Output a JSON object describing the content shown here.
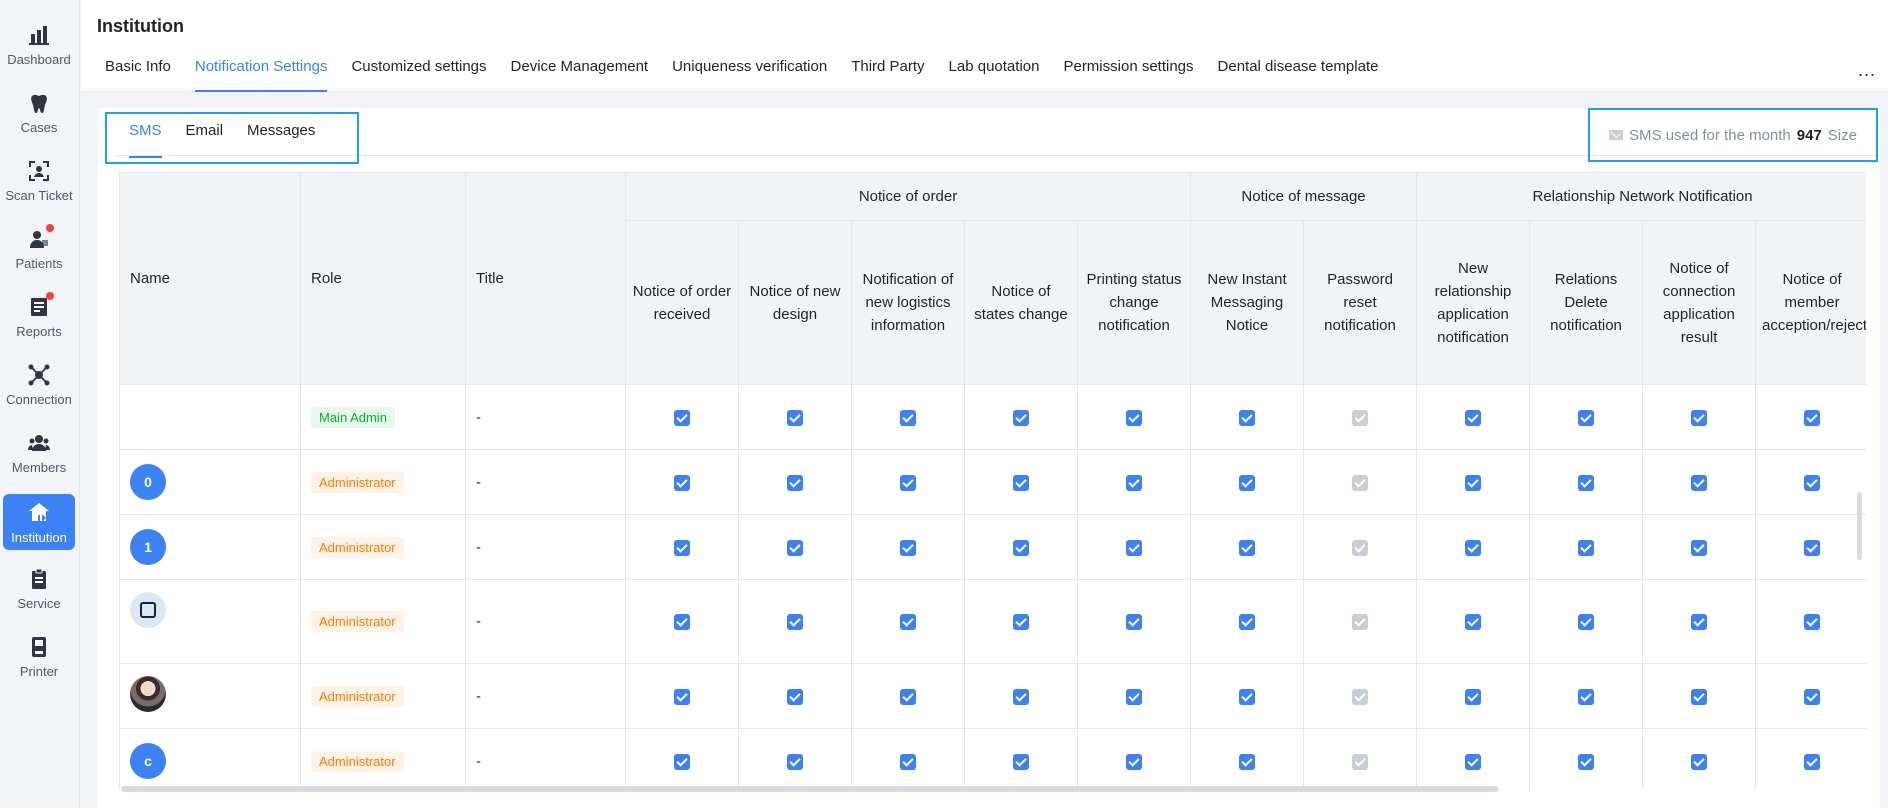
{
  "sidebar": {
    "items": [
      {
        "label": "Dashboard",
        "icon": "dashboard-icon"
      },
      {
        "label": "Cases",
        "icon": "tooth-icon"
      },
      {
        "label": "Scan Ticket",
        "icon": "scan-icon"
      },
      {
        "label": "Patients",
        "icon": "patients-icon"
      },
      {
        "label": "Reports",
        "icon": "reports-icon"
      },
      {
        "label": "Connection",
        "icon": "connection-icon"
      },
      {
        "label": "Members",
        "icon": "members-icon"
      },
      {
        "label": "Institution",
        "icon": "institution-icon"
      },
      {
        "label": "Service",
        "icon": "service-icon"
      },
      {
        "label": "Printer",
        "icon": "printer-icon"
      }
    ]
  },
  "header": {
    "title": "Institution",
    "tabs": [
      "Basic Info",
      "Notification Settings",
      "Customized settings",
      "Device Management",
      "Uniqueness verification",
      "Third Party",
      "Lab quotation",
      "Permission settings",
      "Dental disease template"
    ],
    "active_tab": "Notification Settings",
    "more": "..."
  },
  "subtabs": {
    "items": [
      "SMS",
      "Email",
      "Messages"
    ],
    "active": "SMS"
  },
  "sms_usage": {
    "prefix": "SMS used for the month",
    "count": "947",
    "suffix": "Size"
  },
  "table": {
    "col_name": "Name",
    "col_role": "Role",
    "col_title": "Title",
    "groups": {
      "order": "Notice of order",
      "message": "Notice of message",
      "relationship": "Relationship Network Notification"
    },
    "columns": [
      "Notice of order received",
      "Notice of new design",
      "Notification of new logistics information",
      "Notice of states change",
      "Printing status change notification",
      "New Instant Messaging Notice",
      "Password reset notification",
      "New relationship application notification",
      "Relations Delete notification",
      "Notice of connection application result",
      "Notice of member acception/rejection"
    ],
    "rows": [
      {
        "avatar": "",
        "role": "Main Admin",
        "title": "-"
      },
      {
        "avatar": "0",
        "role": "Administrator",
        "title": "-"
      },
      {
        "avatar": "1",
        "role": "Administrator",
        "title": "-"
      },
      {
        "avatar": "",
        "role": "Administrator",
        "title": "-"
      },
      {
        "avatar": "",
        "role": "Administrator",
        "title": "-"
      },
      {
        "avatar": "c",
        "role": "Administrator",
        "title": "-"
      }
    ]
  }
}
